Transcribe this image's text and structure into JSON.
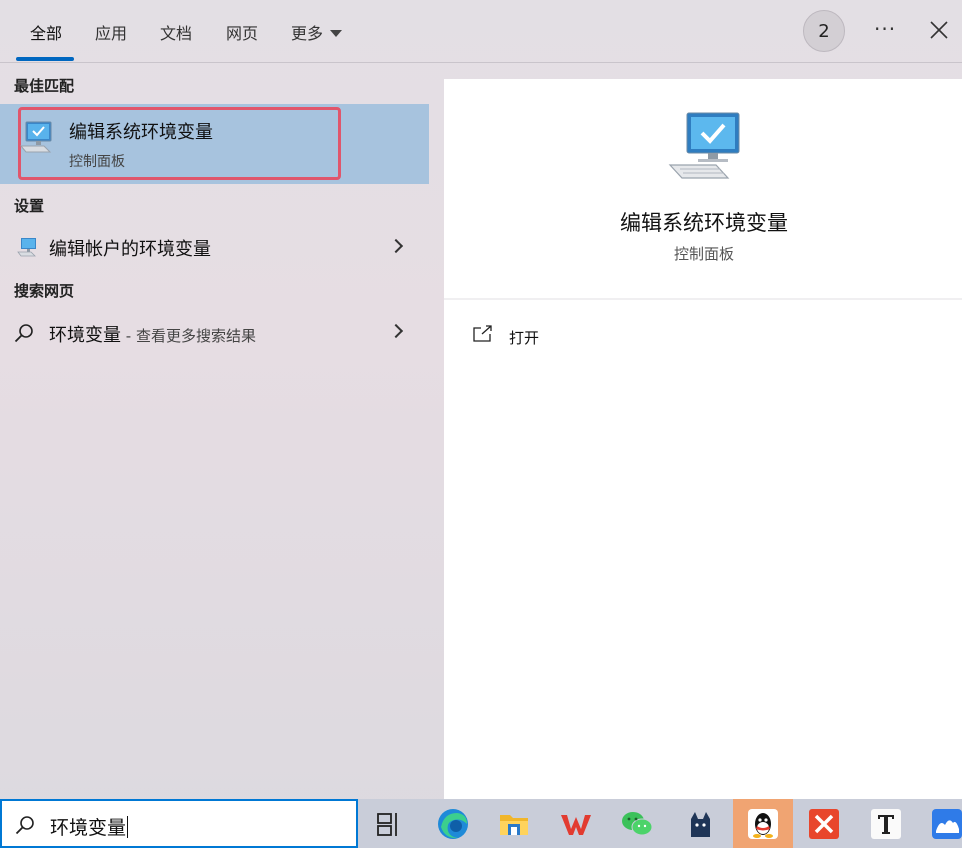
{
  "tabs": [
    {
      "label": "全部"
    },
    {
      "label": "应用"
    },
    {
      "label": "文档"
    },
    {
      "label": "网页"
    },
    {
      "label": "更多"
    }
  ],
  "badge_count": "2",
  "more_options": "···",
  "sections": {
    "best_match": "最佳匹配",
    "settings": "设置",
    "web_search": "搜索网页"
  },
  "best_match_item": {
    "title": "编辑系统环境变量",
    "subtitle": "控制面板"
  },
  "settings_item": {
    "title": "编辑帐户的环境变量"
  },
  "web_item": {
    "title": "环境变量",
    "subtitle": " - 查看更多搜索结果"
  },
  "detail": {
    "title": "编辑系统环境变量",
    "subtitle": "控制面板",
    "open_label": "打开"
  },
  "search": {
    "value": "环境变量"
  },
  "taskbar_icons": [
    "task-view-icon",
    "edge-icon",
    "file-explorer-icon",
    "wps-icon",
    "wechat-icon",
    "cat-app-icon",
    "qq-icon",
    "xmind-icon",
    "typora-icon",
    "lark-icon"
  ],
  "colors": {
    "accent": "#0067c0",
    "selected_bg": "#a7c3de",
    "highlight_outline": "#e0566c",
    "taskbar_bg": "#c9cdd9",
    "active_task_bg": "#f0a472"
  }
}
